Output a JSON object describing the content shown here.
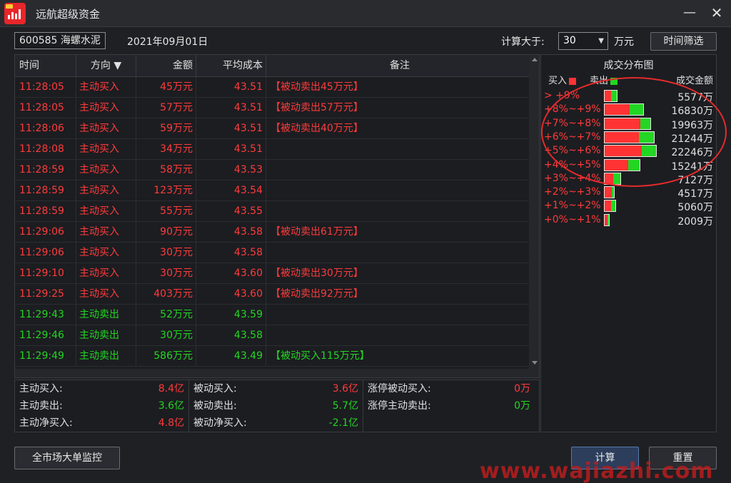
{
  "window": {
    "title": "远航超级资金",
    "minimize_glyph": "—",
    "close_glyph": "✕"
  },
  "toolbar": {
    "stock": "600585 海螺水泥",
    "date": "2021年09月01日",
    "calc_label": "计算大于:",
    "threshold": "30",
    "unit": "万元",
    "time_filter_button": "时间筛选"
  },
  "table": {
    "headers": {
      "time": "时间",
      "direction": "方向 ▼",
      "amount": "金额",
      "avg_cost": "平均成本",
      "note": "备注"
    },
    "rows": [
      {
        "time": "11:28:05",
        "direction": "主动买入",
        "amount": "45万元",
        "avg_cost": "43.51",
        "note": "【被动卖出45万元】",
        "side": "buy"
      },
      {
        "time": "11:28:05",
        "direction": "主动买入",
        "amount": "57万元",
        "avg_cost": "43.51",
        "note": "【被动卖出57万元】",
        "side": "buy"
      },
      {
        "time": "11:28:06",
        "direction": "主动买入",
        "amount": "59万元",
        "avg_cost": "43.51",
        "note": "【被动卖出40万元】",
        "side": "buy"
      },
      {
        "time": "11:28:08",
        "direction": "主动买入",
        "amount": "34万元",
        "avg_cost": "43.51",
        "note": "",
        "side": "buy"
      },
      {
        "time": "11:28:59",
        "direction": "主动买入",
        "amount": "58万元",
        "avg_cost": "43.53",
        "note": "",
        "side": "buy"
      },
      {
        "time": "11:28:59",
        "direction": "主动买入",
        "amount": "123万元",
        "avg_cost": "43.54",
        "note": "",
        "side": "buy"
      },
      {
        "time": "11:28:59",
        "direction": "主动买入",
        "amount": "55万元",
        "avg_cost": "43.55",
        "note": "",
        "side": "buy"
      },
      {
        "time": "11:29:06",
        "direction": "主动买入",
        "amount": "90万元",
        "avg_cost": "43.58",
        "note": "【被动卖出61万元】",
        "side": "buy"
      },
      {
        "time": "11:29:06",
        "direction": "主动买入",
        "amount": "30万元",
        "avg_cost": "43.58",
        "note": "",
        "side": "buy"
      },
      {
        "time": "11:29:10",
        "direction": "主动买入",
        "amount": "30万元",
        "avg_cost": "43.60",
        "note": "【被动卖出30万元】",
        "side": "buy"
      },
      {
        "time": "11:29:25",
        "direction": "主动买入",
        "amount": "403万元",
        "avg_cost": "43.60",
        "note": "【被动卖出92万元】",
        "side": "buy"
      },
      {
        "time": "11:29:43",
        "direction": "主动卖出",
        "amount": "52万元",
        "avg_cost": "43.59",
        "note": "",
        "side": "sell"
      },
      {
        "time": "11:29:46",
        "direction": "主动卖出",
        "amount": "30万元",
        "avg_cost": "43.58",
        "note": "",
        "side": "sell"
      },
      {
        "time": "11:29:49",
        "direction": "主动卖出",
        "amount": "586万元",
        "avg_cost": "43.49",
        "note": "【被动买入115万元】",
        "side": "sell"
      }
    ]
  },
  "summary": {
    "col1": [
      {
        "label": "主动买入:",
        "value": "8.4亿",
        "color": "red"
      },
      {
        "label": "主动卖出:",
        "value": "3.6亿",
        "color": "green"
      },
      {
        "label": "主动净买入:",
        "value": "4.8亿",
        "color": "red"
      }
    ],
    "col2": [
      {
        "label": "被动买入:",
        "value": "3.6亿",
        "color": "red"
      },
      {
        "label": "被动卖出:",
        "value": "5.7亿",
        "color": "green"
      },
      {
        "label": "被动净买入:",
        "value": "-2.1亿",
        "color": "green"
      }
    ],
    "col3": [
      {
        "label": "涨停被动买入:",
        "value": "0万",
        "color": "red"
      },
      {
        "label": "涨停主动卖出:",
        "value": "0万",
        "color": "green"
      }
    ]
  },
  "distribution": {
    "title": "成交分布图",
    "legend_buy": "买入",
    "legend_sell": "卖出",
    "amount_header": "成交金额",
    "buy_color": "#ff3333",
    "sell_color": "#23d623",
    "rows": [
      {
        "label": "> +9%",
        "value": "5577万",
        "amount": 5577,
        "buy_share": 0.55
      },
      {
        "label": "+8%~+9%",
        "value": "16830万",
        "amount": 16830,
        "buy_share": 0.65
      },
      {
        "label": "+7%~+8%",
        "value": "19963万",
        "amount": 19963,
        "buy_share": 0.78
      },
      {
        "label": "+6%~+7%",
        "value": "21244万",
        "amount": 21244,
        "buy_share": 0.7
      },
      {
        "label": "+5%~+6%",
        "value": "22246万",
        "amount": 22246,
        "buy_share": 0.72
      },
      {
        "label": "+4%~+5%",
        "value": "15241万",
        "amount": 15241,
        "buy_share": 0.68
      },
      {
        "label": "+3%~+4%",
        "value": "7127万",
        "amount": 7127,
        "buy_share": 0.55
      },
      {
        "label": "+2%~+3%",
        "value": "4517万",
        "amount": 4517,
        "buy_share": 0.8
      },
      {
        "label": "+1%~+2%",
        "value": "5060万",
        "amount": 5060,
        "buy_share": 0.6
      },
      {
        "label": "+0%~+1%",
        "value": "2009万",
        "amount": 2009,
        "buy_share": 0.7
      }
    ]
  },
  "footer": {
    "market_button": "全市场大单监控",
    "calc_button": "计算",
    "reset_button": "重置",
    "watermark": "www.wajiazhi.com"
  }
}
